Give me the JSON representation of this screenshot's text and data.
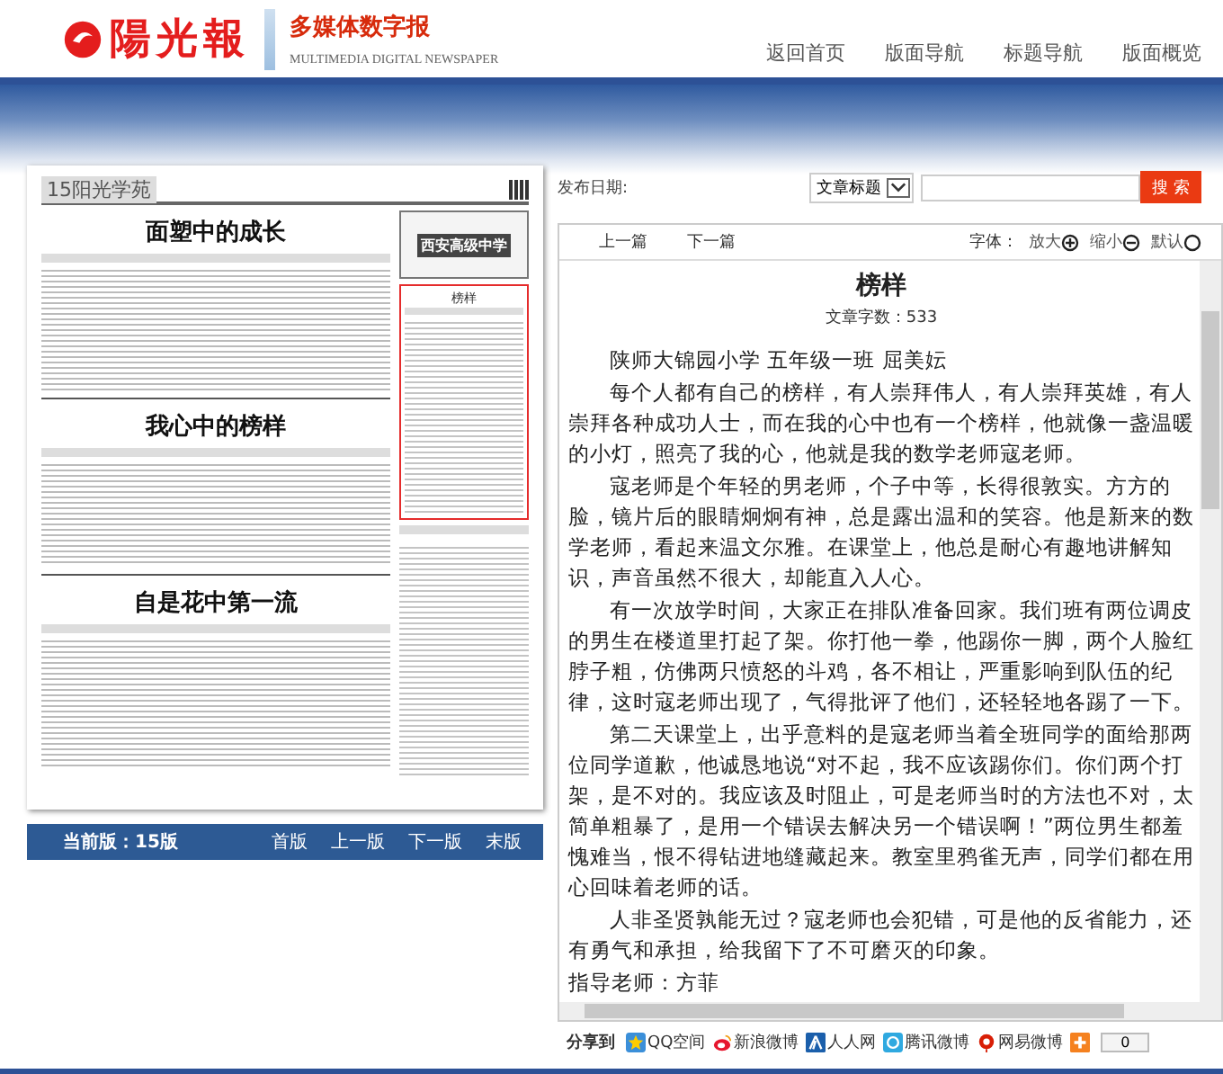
{
  "header": {
    "logo_text": "陽光報",
    "product": "多媒体数字报",
    "product_en": "MULTIMEDIA DIGITAL NEWSPAPER",
    "nav": [
      "返回首页",
      "版面导航",
      "标题导航",
      "版面概览"
    ]
  },
  "page_view": {
    "page_label": "15阳光学苑",
    "ad_title": "西安高级中学",
    "main_articles": [
      {
        "title": "面塑中的成长",
        "selected": false
      },
      {
        "title": "我心中的榜样",
        "selected": false
      },
      {
        "title": "自是花中第一流",
        "selected": false
      }
    ],
    "side_articles": [
      {
        "title": "榜样",
        "selected": true
      }
    ]
  },
  "page_nav": {
    "current_label": "当前版：",
    "current_value": "15版",
    "links": [
      "首版",
      "上一版",
      "下一版",
      "末版"
    ]
  },
  "search": {
    "date_label": "发布日期:",
    "field_type": "文章标题",
    "button": "搜 索"
  },
  "article_toolbar": {
    "prev": "上一篇",
    "next": "下一篇",
    "font_label": "字体：",
    "font_buttons": [
      {
        "label": "放大",
        "kind": "plus"
      },
      {
        "label": "缩小",
        "kind": "minus"
      },
      {
        "label": "默认",
        "kind": "default"
      }
    ]
  },
  "article": {
    "title": "榜样",
    "word_count": "文章字数：533",
    "paragraphs": [
      "陕师大锦园小学 五年级一班 屈美妘",
      "每个人都有自己的榜样，有人崇拜伟人，有人崇拜英雄，有人崇拜各种成功人士，而在我的心中也有一个榜样，他就像一盏温暖的小灯，照亮了我的心，他就是我的数学老师寇老师。",
      "寇老师是个年轻的男老师，个子中等，长得很敦实。方方的脸，镜片后的眼睛炯炯有神，总是露出温和的笑容。他是新来的数学老师，看起来温文尔雅。在课堂上，他总是耐心有趣地讲解知识，声音虽然不很大，却能直入人心。",
      "有一次放学时间，大家正在排队准备回家。我们班有两位调皮的男生在楼道里打起了架。你打他一拳，他踢你一脚，两个人脸红脖子粗，仿佛两只愤怒的斗鸡，各不相让，严重影响到队伍的纪律，这时寇老师出现了，气得批评了他们，还轻轻地各踢了一下。",
      "第二天课堂上，出乎意料的是寇老师当着全班同学的面给那两位同学道歉，他诚恳地说“对不起，我不应该踢你们。你们两个打架，是不对的。我应该及时阻止，可是老师当时的方法也不对，太简单粗暴了，是用一个错误去解决另一个错误啊！”两位男生都羞愧难当，恨不得钻进地缝藏起来。教室里鸦雀无声，同学们都在用心回味着老师的话。",
      "人非圣贤孰能无过？寇老师也会犯错，可是他的反省能力，还有勇气和承担，给我留下了不可磨灭的印象。"
    ],
    "advisor": "指导老师：方菲"
  },
  "share": {
    "label": "分享到",
    "services": [
      {
        "name": "QQ空间",
        "kind": "qzone"
      },
      {
        "name": "新浪微博",
        "kind": "sina"
      },
      {
        "name": "人人网",
        "kind": "renren"
      },
      {
        "name": "腾讯微博",
        "kind": "tencent"
      },
      {
        "name": "网易微博",
        "kind": "netease"
      }
    ],
    "count": "0"
  }
}
